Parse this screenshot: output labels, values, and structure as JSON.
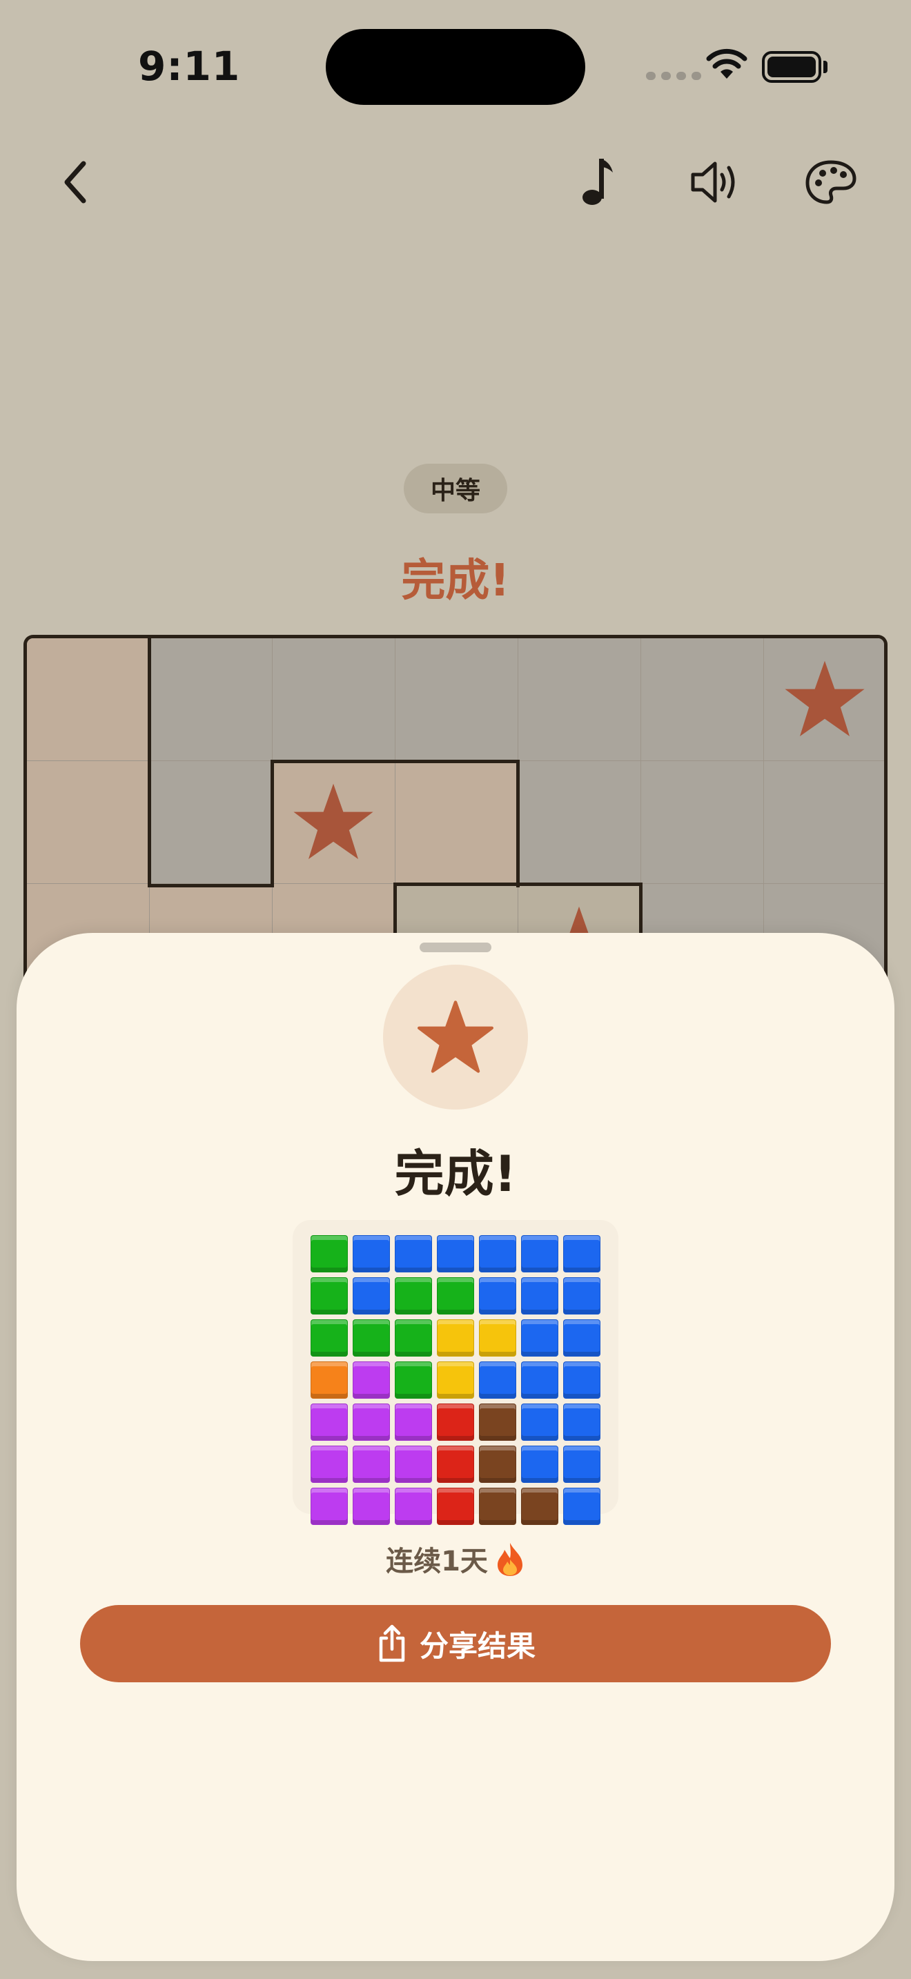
{
  "status_bar": {
    "time": "9:11"
  },
  "toolbar": {
    "back_icon": "chevron-left-icon",
    "music_icon": "music-note-icon",
    "sound_icon": "speaker-icon",
    "theme_icon": "palette-icon"
  },
  "game": {
    "difficulty": "中等",
    "status_title": "完成!"
  },
  "result_sheet": {
    "title": "完成!",
    "streak_text": "连续1天",
    "streak_icon": "flame-icon",
    "share_label": "分享结果",
    "share_icon": "share-icon",
    "grid": [
      [
        "green",
        "blue",
        "blue",
        "blue",
        "blue",
        "blue",
        "blue"
      ],
      [
        "green",
        "blue",
        "green",
        "green",
        "blue",
        "blue",
        "blue"
      ],
      [
        "green",
        "green",
        "green",
        "yellow",
        "yellow",
        "blue",
        "blue"
      ],
      [
        "orange",
        "purple",
        "green",
        "yellow",
        "blue",
        "blue",
        "blue"
      ],
      [
        "purple",
        "purple",
        "purple",
        "red",
        "brown",
        "blue",
        "blue"
      ],
      [
        "purple",
        "purple",
        "purple",
        "red",
        "brown",
        "blue",
        "blue"
      ],
      [
        "purple",
        "purple",
        "purple",
        "red",
        "brown",
        "brown",
        "blue"
      ]
    ]
  },
  "colors": {
    "accent": "#c5653a",
    "star": "#a8553a",
    "title": "#b65c39",
    "board_gray": "#aaa59c",
    "board_tan": "#c1ae9b",
    "board_olive": "#b9b09e",
    "tile_green": "#16b21a",
    "tile_blue": "#1c67f0",
    "tile_yellow": "#f6c40c",
    "tile_orange": "#f6821a",
    "tile_purple": "#bd3cf0",
    "tile_red": "#dc2418",
    "tile_brown": "#7a4420"
  }
}
